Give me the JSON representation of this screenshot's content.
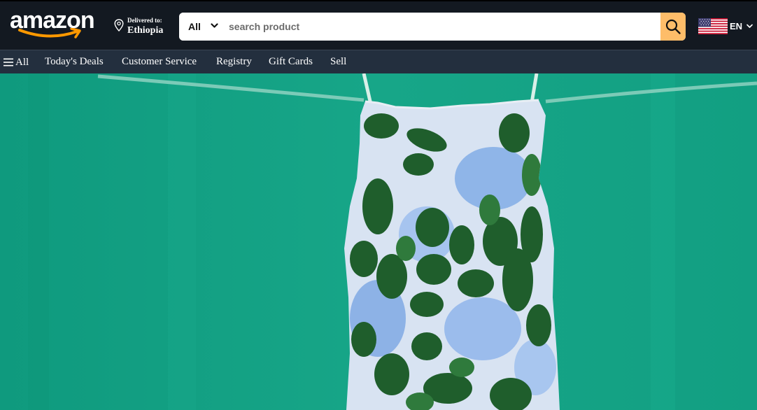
{
  "header": {
    "logo_text": "amazon",
    "deliver_label": "Delivered to:",
    "deliver_country": "Ethiopia",
    "search": {
      "category": "All",
      "placeholder": "search product"
    },
    "language": "EN"
  },
  "nav": {
    "all_label": "All",
    "items": [
      {
        "label": "Today's Deals"
      },
      {
        "label": "Customer Service"
      },
      {
        "label": "Registry"
      },
      {
        "label": "Gift Cards"
      },
      {
        "label": "Sell"
      }
    ]
  },
  "colors": {
    "topbar": "#131921",
    "navbar": "#232f3e",
    "search_button": "#febd69",
    "logo_smile": "#ff9900",
    "hero_background": "#14a184"
  },
  "icons": {
    "location": "map-pin-icon",
    "search": "search-icon",
    "menu": "hamburger-icon",
    "flag": "us-flag-icon"
  }
}
